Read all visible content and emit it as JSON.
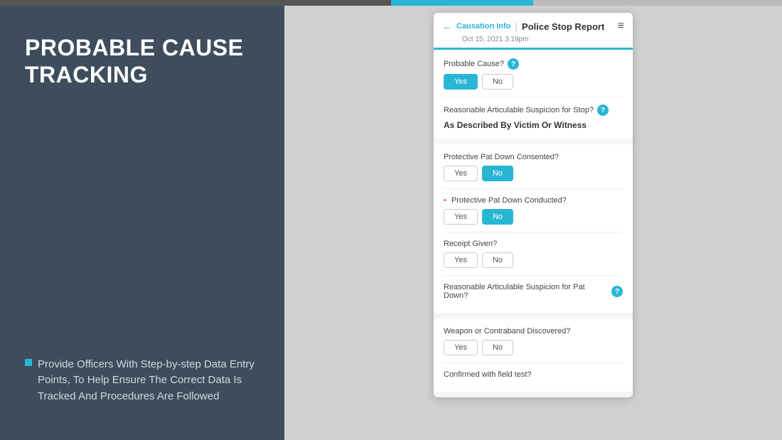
{
  "topBar": {
    "darkWidth": "550px",
    "blueWidth": "200px"
  },
  "leftPanel": {
    "title": "PROBABLE CAUSE\nTRACKING",
    "bulletIcon": "■",
    "bulletText": "Provide Officers With Step-by-step Data Entry Points, To Help Ensure The Correct Data Is Tracked And Procedures Are Followed"
  },
  "formHeader": {
    "backArrow": "←",
    "causationLabel": "Causation Info",
    "pipe": "|",
    "reportTitle": "Police Stop Report",
    "dateLabel": "Oct 15, 2021 3:19pm",
    "menuIcon": "≡"
  },
  "form": {
    "sections": [
      {
        "id": "probable-cause",
        "fields": [
          {
            "id": "probable-cause-field",
            "label": "Probable Cause?",
            "hasHelp": true,
            "required": false,
            "type": "yesno",
            "selectedValue": "Yes"
          },
          {
            "id": "reasonable-articulable-stop",
            "label": "Reasonable Articulable Suspicion for Stop?",
            "hasHelp": true,
            "required": false,
            "type": "text-value",
            "value": "As Described By Victim Or Witness"
          }
        ]
      },
      {
        "id": "pat-down",
        "fields": [
          {
            "id": "protective-pat-consented",
            "label": "Protective Pat Down Consented?",
            "hasHelp": false,
            "required": false,
            "type": "yesno",
            "selectedValue": "No"
          },
          {
            "id": "protective-pat-conducted",
            "label": "Protective Pat Down Conducted?",
            "hasHelp": false,
            "required": true,
            "type": "yesno",
            "selectedValue": "No"
          },
          {
            "id": "receipt-given",
            "label": "Receipt Given?",
            "hasHelp": false,
            "required": false,
            "type": "yesno",
            "selectedValue": null
          },
          {
            "id": "reasonable-articulable-pat",
            "label": "Reasonable Articulable Suspicion for Pat Down?",
            "hasHelp": true,
            "required": false,
            "type": "empty",
            "value": ""
          }
        ]
      },
      {
        "id": "weapon",
        "fields": [
          {
            "id": "weapon-discovered",
            "label": "Weapon or Contraband Discovered?",
            "hasHelp": false,
            "required": false,
            "type": "yesno",
            "selectedValue": null
          },
          {
            "id": "confirmed-field-test",
            "label": "Confirmed with field test?",
            "hasHelp": false,
            "required": false,
            "type": "empty",
            "value": ""
          }
        ]
      }
    ],
    "yesLabel": "Yes",
    "noLabel": "No",
    "helpLabel": "?"
  }
}
